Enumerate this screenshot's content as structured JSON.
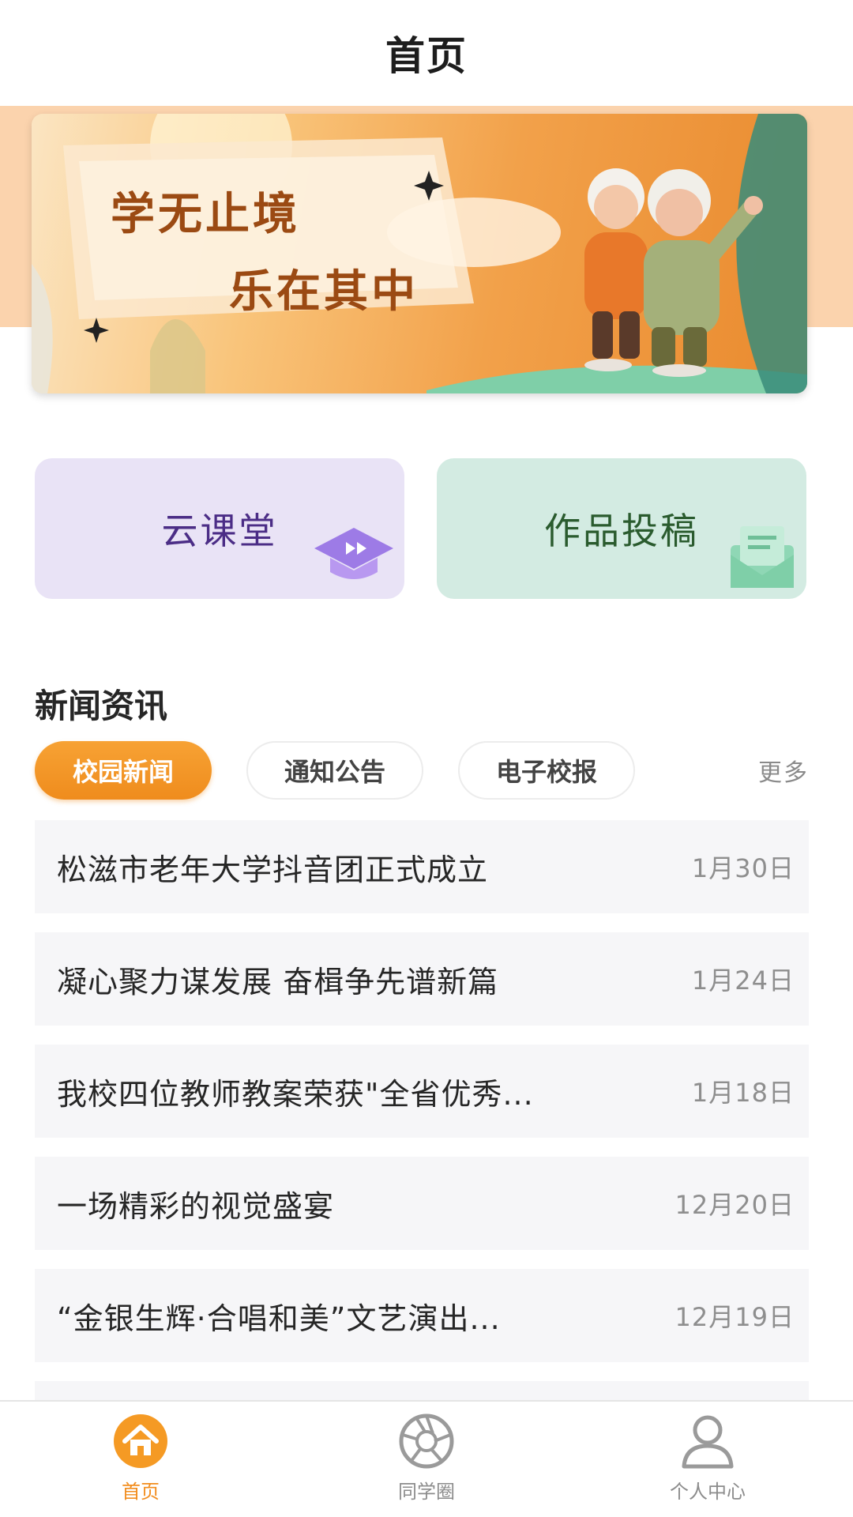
{
  "header": {
    "title": "首页"
  },
  "banner": {
    "line1": "学无止境",
    "line2": "乐在其中"
  },
  "quick_cards": [
    {
      "label": "云课堂",
      "icon": "graduation-cap-icon"
    },
    {
      "label": "作品投稿",
      "icon": "envelope-icon"
    }
  ],
  "news_section": {
    "title": "新闻资讯",
    "tabs": [
      "校园新闻",
      "通知公告",
      "电子校报"
    ],
    "active_tab": "校园新闻",
    "more_label": "更多",
    "items": [
      {
        "title": "松滋市老年大学抖音团正式成立",
        "date": "1月30日"
      },
      {
        "title": "凝心聚力谋发展 奋楫争先谱新篇",
        "date": "1月24日"
      },
      {
        "title": "我校四位教师教案荣获\"全省优秀...",
        "date": "1月18日"
      },
      {
        "title": "一场精彩的视觉盛宴",
        "date": "12月20日"
      },
      {
        "title": "“金银生辉·合唱和美”文艺演出...",
        "date": "12月19日"
      }
    ]
  },
  "tabbar": {
    "items": [
      {
        "label": "首页",
        "icon": "home-icon",
        "active": true
      },
      {
        "label": "同学圈",
        "icon": "aperture-icon",
        "active": false
      },
      {
        "label": "个人中心",
        "icon": "user-icon",
        "active": false
      }
    ],
    "accent_color": "#f28d1e"
  },
  "colors": {
    "accent": "#f0901f",
    "card_cloud_bg": "#e9e3f6",
    "card_submit_bg": "#d3ebe2"
  }
}
